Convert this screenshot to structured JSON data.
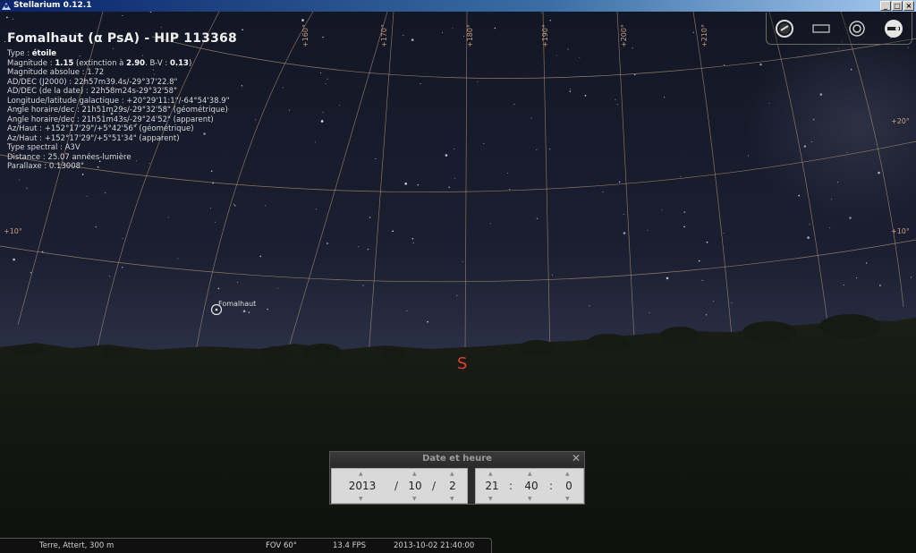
{
  "window": {
    "title": "Stellarium 0.12.1",
    "buttons": [
      "_",
      "□",
      "×"
    ]
  },
  "object_info": {
    "title": "Fomalhaut (α PsA) - HIP 113368",
    "type_label": "Type : ",
    "type_value": "étoile",
    "magnitude_label": "Magnitude : ",
    "magnitude_value": "1.15",
    "extinction_label": " (extinction à ",
    "extinction_value": "2.90",
    "bv_label": ". B-V : ",
    "bv_value": "0.13",
    "bv_close": ")",
    "lines": [
      "Magnitude absolue : 1.72",
      "AD/DEC (J2000) : 22h57m39.4s/-29°37'22.8\"",
      "AD/DEC (de la date) : 22h58m24s-29°32'58\"",
      "Longitude/latitude galactique : +20°29'11:1\"/-64°54'38.9\"",
      "Angle horaire/dec : 21h51m29s/-29°32'58\" (géométrique)",
      "Angle horaire/dec : 21h51m43s/-29°24'52\" (apparent)",
      "Az/Haut : +152°17'29\"/+5°42'56\" (géométrique)",
      "Az/Haut : +152°17'29\"/+5°51'34\" (apparent)",
      "Type spectral : A3V",
      "Distance : 25.07 années-lumière",
      "Parallaxe : 0.13008\""
    ]
  },
  "toolbar": {
    "icons": [
      "telescope-icon",
      "screen-icon",
      "ocular-icon",
      "ccd-icon"
    ]
  },
  "sky": {
    "star_label": "Fomalhaut",
    "cardinal": "S",
    "grid_labels_top": [
      "+160°",
      "+170°",
      "+180°",
      "+190°",
      "+200°",
      "+210°"
    ],
    "grid_labels_alt": [
      "+10°",
      "+10°",
      "+20°"
    ]
  },
  "datetime_dialog": {
    "title": "Date et heure",
    "year": "2013",
    "month": "10",
    "day": "2",
    "hour": "21",
    "minute": "40",
    "second": "0",
    "date_sep": "/",
    "time_sep": ":"
  },
  "statusbar": {
    "location": "Terre, Attert, 300 m",
    "fov": "FOV 60°",
    "fps": "13.4 FPS",
    "datetime": "2013-10-02   21:40:00"
  },
  "colors": {
    "sky_top": "#141726",
    "sky_horizon": "#24283c",
    "ground": "#121510",
    "cardinal": "#e0412c",
    "grid": "#c8a080"
  }
}
